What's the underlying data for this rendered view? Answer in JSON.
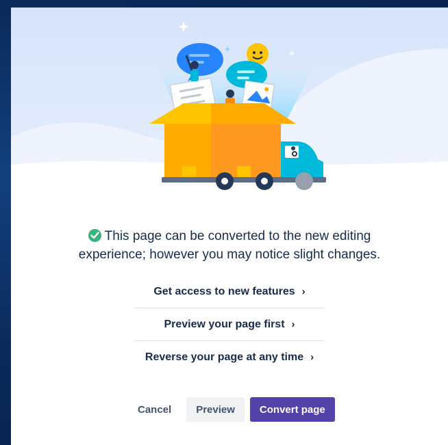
{
  "dialog": {
    "message_line1": "This page can be converted to the new editing",
    "message_line2": "experience; however you may notice slight changes."
  },
  "benefits": [
    {
      "label": "Get access to new features"
    },
    {
      "label": "Preview your page first"
    },
    {
      "label": "Reverse your page at any time"
    }
  ],
  "actions": {
    "cancel_label": "Cancel",
    "preview_label": "Preview",
    "convert_label": "Convert page"
  },
  "colors": {
    "primary": "#5243aa",
    "success": "#36b37e",
    "text": "#172b4d",
    "backdrop": "#0b2a5a"
  }
}
